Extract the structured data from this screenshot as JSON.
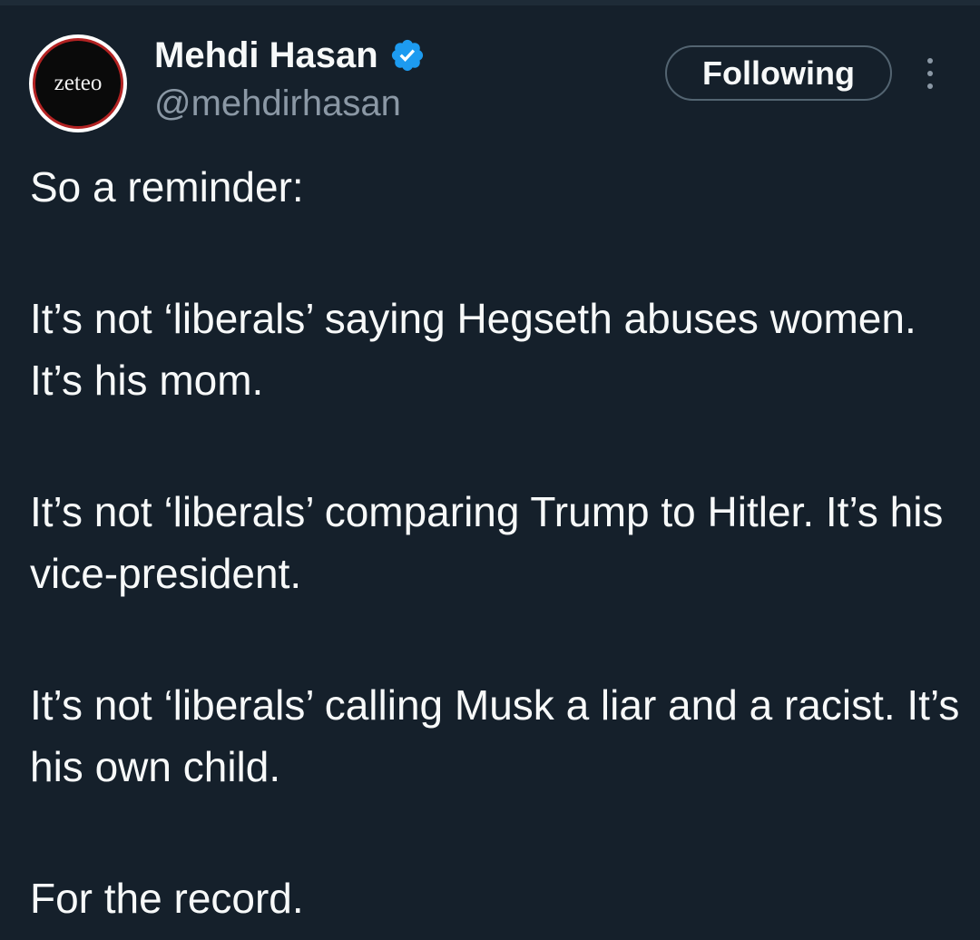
{
  "author": {
    "avatar_text": "zeteo",
    "display_name": "Mehdi Hasan",
    "handle": "@mehdirhasan",
    "verified": true
  },
  "actions": {
    "follow_label": "Following"
  },
  "tweet": {
    "paragraphs": [
      "So a reminder:",
      "It’s not ‘liberals’ saying Hegseth abuses women. It’s his mom.",
      "It’s not ‘liberals’ comparing Trump to Hitler. It’s his vice-president.",
      "It’s not ‘liberals’ calling Musk a liar and a racist. It’s his own child.",
      "For the record."
    ]
  },
  "colors": {
    "background": "#15202b",
    "text": "#f7f9f9",
    "secondary": "#8b98a5",
    "verified_badge": "#1d9bf0",
    "button_border": "#536471"
  },
  "icons": {
    "verified": "verified-badge-icon",
    "more": "more-vertical-icon"
  }
}
